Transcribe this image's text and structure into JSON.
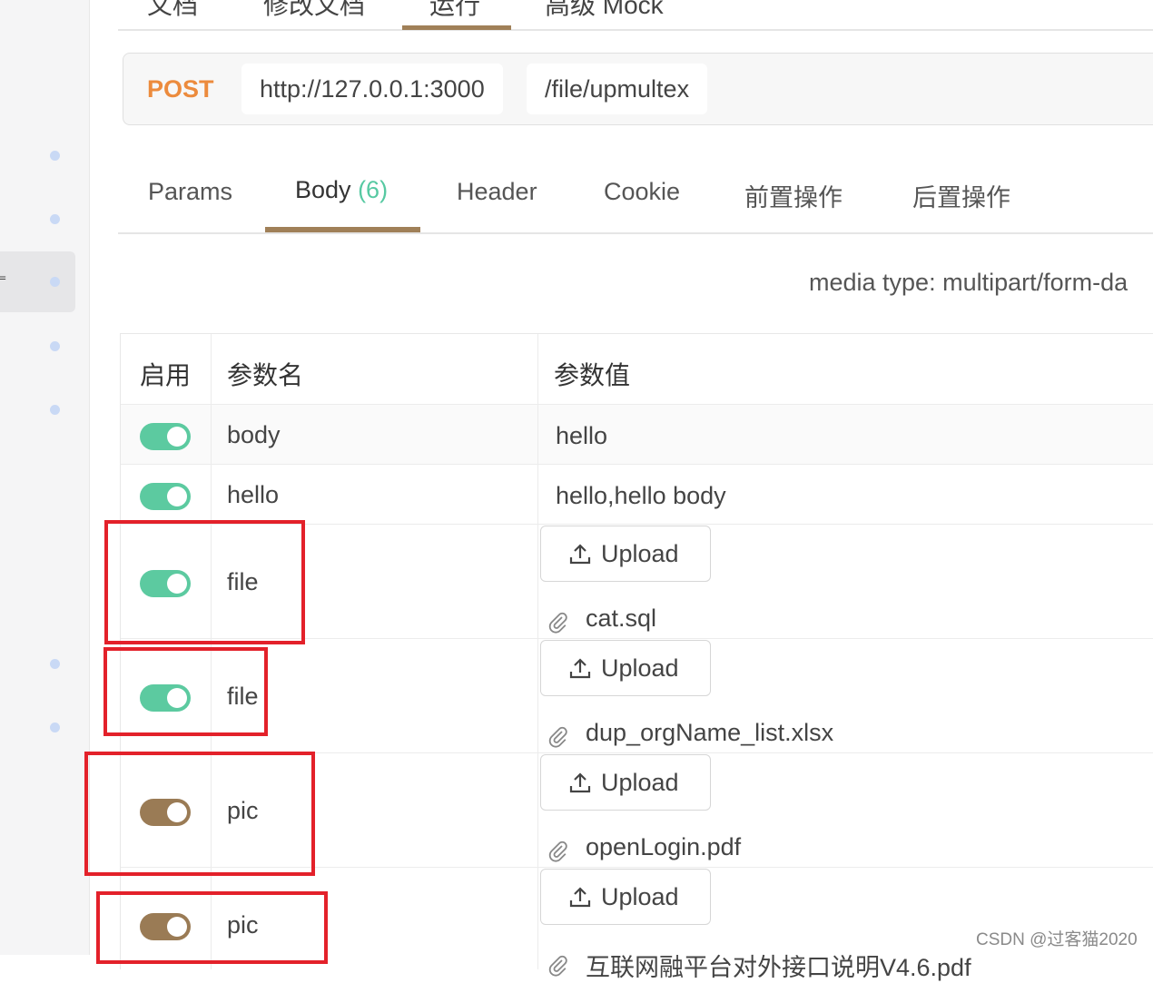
{
  "top_tabs": [
    "文档",
    "修改文档",
    "运行",
    "高级 Mock"
  ],
  "request": {
    "method": "POST",
    "base_url": "http://127.0.0.1:3000",
    "path": "/file/upmultex"
  },
  "tabs": [
    {
      "label": "Params"
    },
    {
      "label": "Body",
      "count": "(6)"
    },
    {
      "label": "Header"
    },
    {
      "label": "Cookie"
    },
    {
      "label": "前置操作"
    },
    {
      "label": "后置操作"
    }
  ],
  "active_tab": "Body",
  "media_type": "media type: multipart/form-da",
  "table": {
    "headers": {
      "enabled": "启用",
      "name": "参数名",
      "value": "参数值"
    },
    "rows": [
      {
        "enabled": true,
        "name": "body",
        "value": "hello"
      },
      {
        "enabled": true,
        "name": "hello",
        "value": "hello,hello body"
      },
      {
        "enabled": true,
        "name": "file",
        "upload_label": "Upload",
        "file": "cat.sql"
      },
      {
        "enabled": true,
        "name": "file",
        "upload_label": "Upload",
        "file": "dup_orgName_list.xlsx"
      },
      {
        "enabled": false,
        "name": "pic",
        "upload_label": "Upload",
        "file": "openLogin.pdf"
      },
      {
        "enabled": false,
        "name": "pic",
        "upload_label": "Upload",
        "file": "互联网融平台对外接口说明V4.6.pdf"
      }
    ]
  },
  "watermark": "CSDN @过客猫2020",
  "colors": {
    "accent": "#a08058",
    "method": "#ec8b3d",
    "toggle_on": "#5ccaa0",
    "toggle_off": "#9a7b55",
    "highlight_box": "#e3212a"
  }
}
